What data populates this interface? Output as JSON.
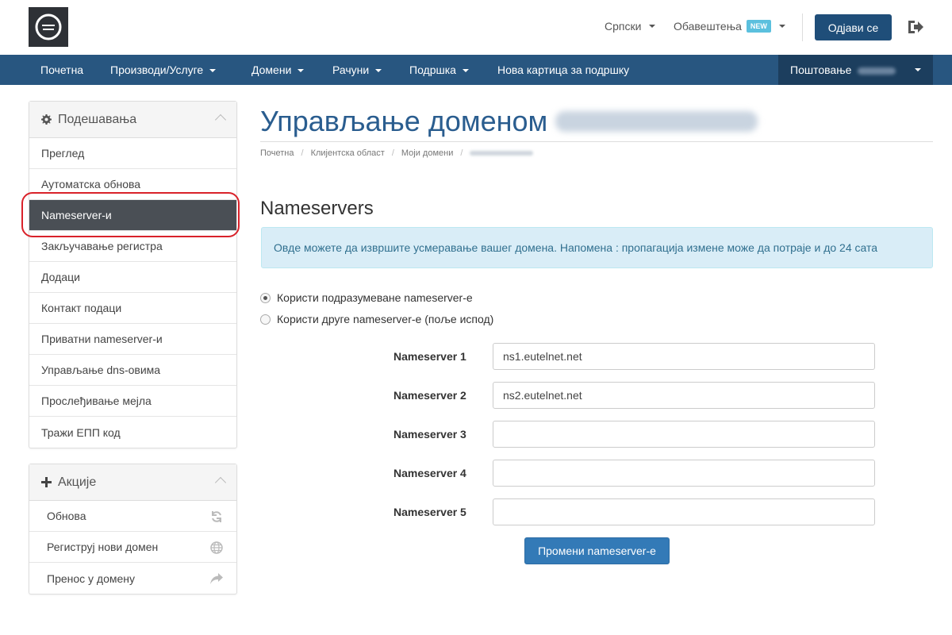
{
  "header": {
    "language": "Српски",
    "notifications": "Обавештења",
    "notifications_badge": "NEW",
    "logout_label": "Одјави се"
  },
  "navbar": {
    "items": [
      {
        "label": "Почетна",
        "has_caret": false
      },
      {
        "label": "Производи/Услуге",
        "has_caret": true
      },
      {
        "label": "Домени",
        "has_caret": true
      },
      {
        "label": "Рачуни",
        "has_caret": true
      },
      {
        "label": "Подршка",
        "has_caret": true
      },
      {
        "label": "Нова картица за подршку",
        "has_caret": false
      }
    ],
    "greeting": "Поштовање"
  },
  "sidebar": {
    "settings": {
      "title": "Подешавања",
      "items": [
        {
          "label": "Преглед"
        },
        {
          "label": "Аутоматска обнова"
        },
        {
          "label": "Nameserver-и",
          "active": true
        },
        {
          "label": "Закључавање регистра"
        },
        {
          "label": "Додаци"
        },
        {
          "label": "Контакт подаци"
        },
        {
          "label": "Приватни nameserver-и"
        },
        {
          "label": "Управљање dns-овима"
        },
        {
          "label": "Прослеђивање мејла"
        },
        {
          "label": "Тражи ЕПП код"
        }
      ]
    },
    "actions": {
      "title": "Акције",
      "items": [
        {
          "label": "Обнова",
          "icon": "refresh-icon"
        },
        {
          "label": "Региструј нови домен",
          "icon": "globe-icon"
        },
        {
          "label": "Пренос у домену",
          "icon": "share-arrow-icon"
        }
      ]
    }
  },
  "main": {
    "title": "Управљање доменом",
    "breadcrumb": [
      "Почетна",
      "Клијентска област",
      "Моји домени"
    ],
    "section_title": "Nameservers",
    "info": "Овде можете да извршите усмеравање вашег домена. Напомена : пропагација измене може да потраје и до 24 сата",
    "radio_default": "Користи подразумеване nameserver-е",
    "radio_custom": "Користи друге nameserver-е (поље испод)",
    "nameservers": [
      {
        "label": "Nameserver 1",
        "value": "ns1.eutelnet.net"
      },
      {
        "label": "Nameserver 2",
        "value": "ns2.eutelnet.net"
      },
      {
        "label": "Nameserver 3",
        "value": ""
      },
      {
        "label": "Nameserver 4",
        "value": ""
      },
      {
        "label": "Nameserver 5",
        "value": ""
      }
    ],
    "submit_label": "Промени nameserver-е"
  },
  "colors": {
    "navbar": "#285680",
    "accent": "#1f4e79",
    "active_item": "#4a4f55",
    "title": "#2a5d8f",
    "highlight": "#d9222a"
  }
}
